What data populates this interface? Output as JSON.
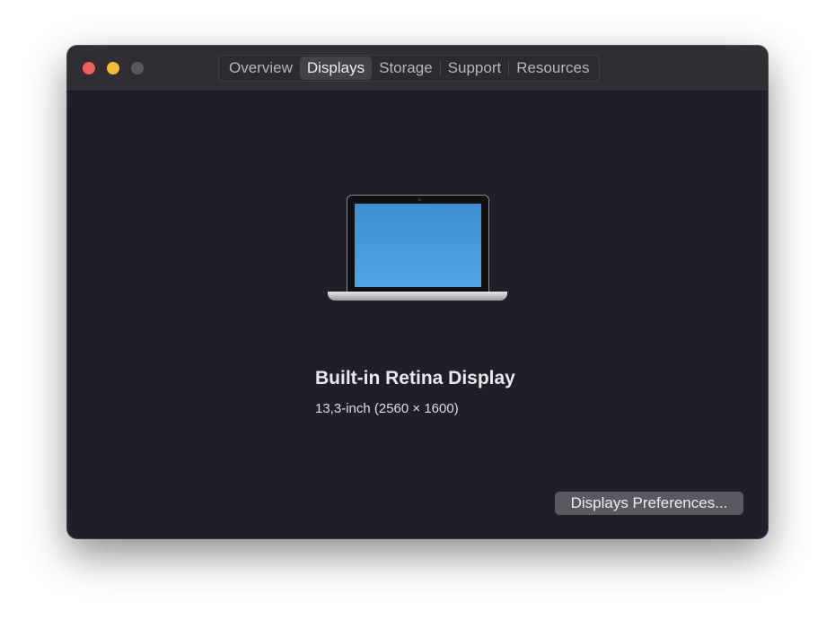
{
  "window": {
    "traffic_lights": {
      "close": "#ec5f5a",
      "minimize": "#f4bd31",
      "zoom": "#5a585d"
    }
  },
  "tabs": [
    {
      "label": "Overview"
    },
    {
      "label": "Displays",
      "active": true
    },
    {
      "label": "Storage"
    },
    {
      "label": "Support"
    },
    {
      "label": "Resources"
    }
  ],
  "display": {
    "name": "Built-in Retina Display",
    "details": "13,3-inch (2560 × 1600)"
  },
  "buttons": {
    "preferences": "Displays Preferences..."
  }
}
